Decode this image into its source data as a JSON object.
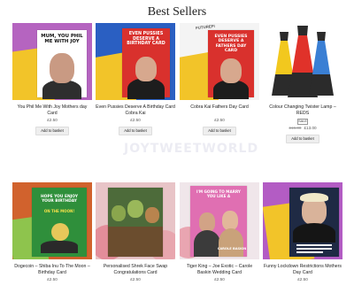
{
  "heading": "Best Sellers",
  "add_label": "Add to basket",
  "watermark": "JOYTWEETWORLD",
  "products": [
    {
      "title": "You Phil Me With Joy Mothers day Card",
      "price": "£2.50",
      "art_text": "MUM, YOU PHIL ME WITH JOY"
    },
    {
      "title": "Even Pussies Deserve A Birthday Card Cobra Kai",
      "price": "£2.50",
      "art_text": "EVEN PUSSIES DESERVE A BIRTHDAY CARD"
    },
    {
      "title": "Cobra Kai Fathers Day Card",
      "price": "£2.50",
      "art_text": "EVEN PUSSIES DESERVE A FATHERS DAY CARD",
      "art_top": "FUTUREFI"
    },
    {
      "title": "Colour Changing Twister Lamp – REDS",
      "old_price": "£16.00",
      "price": "£13.00",
      "sale": "SALE"
    },
    {
      "title": "Dogecoin – Shiba Inu To The Moon – Birthday Card",
      "price": "£2.50",
      "art_text": "HOPE YOU ENJOY YOUR BIRTHDAY",
      "art_sub": "ON THE MOON!"
    },
    {
      "title": "Personalised Shrek Face Swap Congratulations Card",
      "price": "£2.50"
    },
    {
      "title": "Tiger King – Joe Exotic – Carole Baskin Wedding Card",
      "price": "£2.50",
      "art_text": "I'M GOING TO MARRY YOU LIKE A",
      "art_sub": "CAROLE BASKIN"
    },
    {
      "title": "Funny Lockdown Restrictions Mothers Day Card",
      "price": "£2.50"
    }
  ],
  "colors": {
    "lamp_red": "#e0322a",
    "lamp_yellow": "#f2c81e",
    "lamp_blue": "#3a7fd4"
  }
}
